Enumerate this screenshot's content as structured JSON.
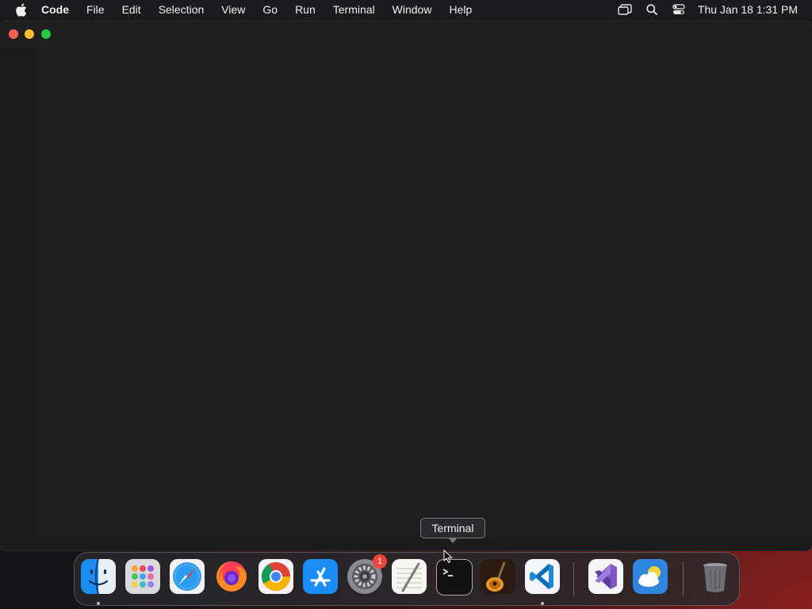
{
  "menubar": {
    "app_name": "Code",
    "items": [
      "File",
      "Edit",
      "Selection",
      "View",
      "Go",
      "Run",
      "Terminal",
      "Window",
      "Help"
    ],
    "clock": "Thu Jan 18  1:31 PM",
    "icons": [
      "screen-mirroring-icon",
      "search-icon",
      "control-center-icon"
    ]
  },
  "window": {
    "app": "Visual Studio Code"
  },
  "tooltip": {
    "text": "Terminal"
  },
  "dock": {
    "apps": [
      {
        "name": "Finder",
        "icon": "finder-icon",
        "running": true
      },
      {
        "name": "Launchpad",
        "icon": "launchpad-icon",
        "running": false
      },
      {
        "name": "Safari",
        "icon": "safari-icon",
        "running": false
      },
      {
        "name": "Firefox",
        "icon": "firefox-icon",
        "running": false
      },
      {
        "name": "Google Chrome",
        "icon": "chrome-icon",
        "running": false
      },
      {
        "name": "App Store",
        "icon": "app-store-icon",
        "running": false
      },
      {
        "name": "System Settings",
        "icon": "system-settings-icon",
        "running": false,
        "badge": "1"
      },
      {
        "name": "TextEdit",
        "icon": "textedit-icon",
        "running": false
      },
      {
        "name": "Terminal",
        "icon": "terminal-icon",
        "running": false
      },
      {
        "name": "GarageBand",
        "icon": "garageband-icon",
        "running": false
      },
      {
        "name": "Visual Studio Code",
        "icon": "vscode-icon",
        "running": true
      },
      {
        "name": "Visual Studio",
        "icon": "visual-studio-icon",
        "running": false
      },
      {
        "name": "Weather",
        "icon": "weather-icon",
        "running": false
      },
      {
        "name": "Trash",
        "icon": "trash-icon",
        "running": false
      }
    ]
  }
}
